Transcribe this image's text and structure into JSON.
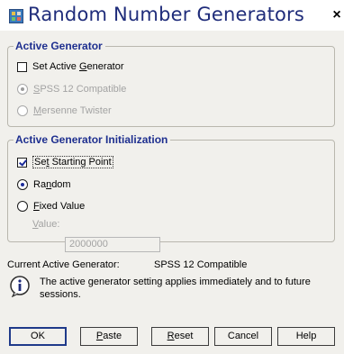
{
  "window": {
    "title": "Random Number Generators",
    "close_glyph": "×",
    "app_icon": "spss-app-icon"
  },
  "active_generator": {
    "group_title": "Active Generator",
    "set_active": {
      "label_pre": "Set Active ",
      "label_key": "G",
      "label_post": "enerator",
      "checked": false
    },
    "options": [
      {
        "label_pre": "",
        "label_key": "S",
        "label_post": "PSS 12 Compatible",
        "selected": true,
        "enabled": false
      },
      {
        "label_pre": "",
        "label_key": "M",
        "label_post": "ersenne Twister",
        "selected": false,
        "enabled": false
      }
    ]
  },
  "initialization": {
    "group_title": "Active Generator Initialization",
    "set_starting_point": {
      "label_pre": "Se",
      "label_key": "t",
      "label_post": " Starting Point",
      "checked": true
    },
    "options": [
      {
        "label_pre": "Ra",
        "label_key": "n",
        "label_post": "dom",
        "selected": true
      },
      {
        "label_pre": "",
        "label_key": "F",
        "label_post": "ixed Value",
        "selected": false
      }
    ],
    "value": {
      "label_key": "V",
      "label_post": "alue:",
      "text": "2000000"
    }
  },
  "status": {
    "label": "Current Active Generator:",
    "value": "SPSS 12 Compatible"
  },
  "info": {
    "icon": "info-icon",
    "text": "The active generator setting applies immediately and to future sessions."
  },
  "buttons": [
    {
      "pre": "",
      "key": "",
      "post": "OK",
      "default": true
    },
    {
      "pre": "",
      "key": "P",
      "post": "aste",
      "default": false
    },
    {
      "pre": "",
      "key": "R",
      "post": "eset",
      "default": false
    },
    {
      "pre": "",
      "key": "",
      "post": "Cancel",
      "default": false
    },
    {
      "pre": "",
      "key": "",
      "post": "Help",
      "default": false
    }
  ],
  "colors": {
    "title_text": "#1f2c7a",
    "group_title": "#1e2f8f",
    "dialog_bg": "#f1f0ec"
  }
}
